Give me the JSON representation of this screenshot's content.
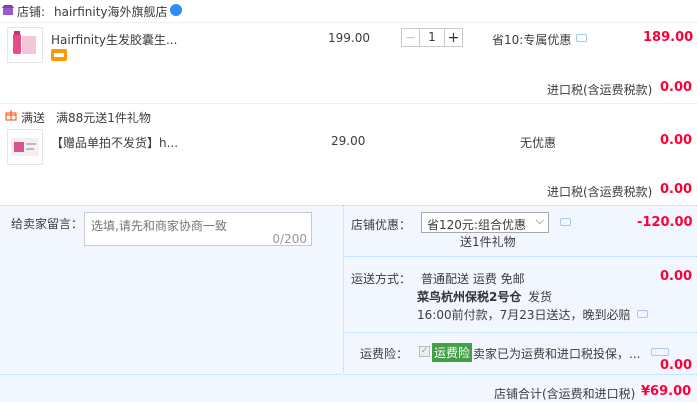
{
  "shop": {
    "label": "店铺:",
    "name": "hairfinity海外旗舰店"
  },
  "item1": {
    "title": "Hairfinity生发胶囊生...",
    "price": "199.00",
    "quantity": "1",
    "promo": "省10:专属优惠",
    "subtotal": "189.00",
    "tax_label": "进口税(含运费税款)",
    "tax_value": "0.00",
    "colors": {
      "thumb": "#d93a78"
    }
  },
  "gift": {
    "tag": "满送",
    "text": "满88元送1件礼物"
  },
  "item2": {
    "title": "【赠品单拍不发货】h...",
    "price": "29.00",
    "promo": "无优惠",
    "subtotal": "0.00",
    "tax_label": "进口税(含运费税款)",
    "tax_value": "0.00"
  },
  "message": {
    "label": "给卖家留言：",
    "placeholder": "选填,请先和商家协商一致",
    "counter": "0/200"
  },
  "shop_discount": {
    "label": "店铺优惠：",
    "selected": "省120元:组合优惠",
    "detail": "送1件礼物",
    "value": "-120.00"
  },
  "shipping": {
    "label": "运送方式：",
    "method": "普通配送 运费 免邮",
    "warehouse": "菜鸟杭州保税2号仓",
    "dispatch": "发货",
    "promise": "16:00前付款，7月23日送达，晚到必赔",
    "value": "0.00"
  },
  "insurance": {
    "label": "运费险：",
    "badge": "运费险",
    "text": "卖家已为运费和进口税投保，...",
    "value": "0.00"
  },
  "total": {
    "label": "店铺合计(含运费和进口税)",
    "value": "¥69.00"
  }
}
